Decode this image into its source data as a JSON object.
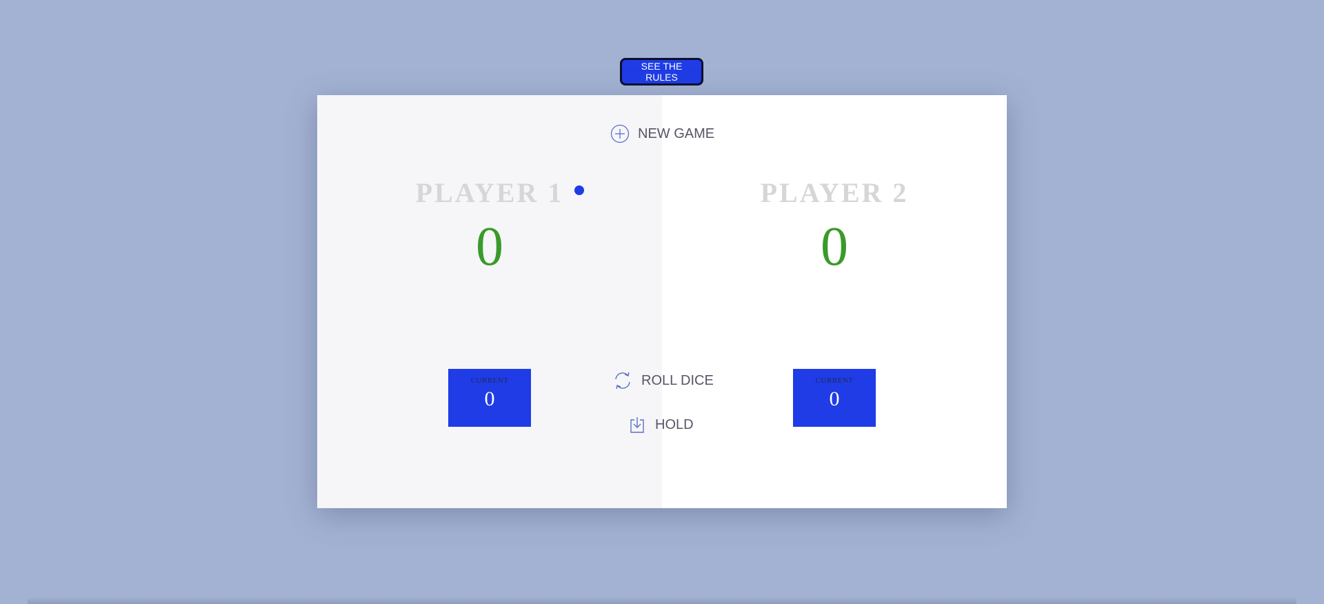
{
  "rules_button": {
    "label": "SEE THE RULES"
  },
  "controls": {
    "new_game": {
      "label": "NEW GAME",
      "icon": "plus-circle-icon"
    },
    "roll_dice": {
      "label": "ROLL DICE",
      "icon": "refresh-icon"
    },
    "hold": {
      "label": "HOLD",
      "icon": "download-icon"
    }
  },
  "players": [
    {
      "name": "PLAYER 1",
      "score": "0",
      "current_label": "CURRENT",
      "current_value": "0",
      "active": true
    },
    {
      "name": "PLAYER 2",
      "score": "0",
      "current_label": "CURRENT",
      "current_value": "0",
      "active": false
    }
  ],
  "colors": {
    "background": "#a3b2d2",
    "accent": "#1f3ce6",
    "score": "#3a9a2a",
    "player_name": "#d6d6d8",
    "active_panel": "#f6f6f8"
  }
}
